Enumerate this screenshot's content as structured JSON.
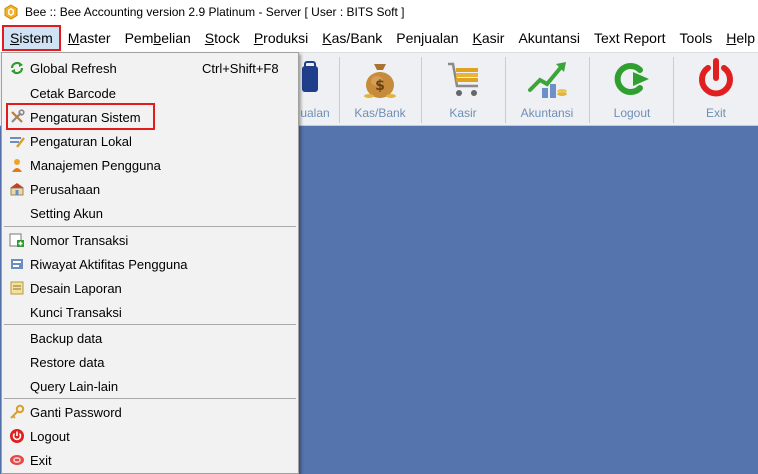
{
  "window": {
    "title": "Bee :: Bee Accounting version 2.9 Platinum - Server  [ User : BITS Soft ]"
  },
  "menubar": [
    {
      "pre": "",
      "u": "S",
      "post": "istem"
    },
    {
      "pre": "",
      "u": "M",
      "post": "aster"
    },
    {
      "pre": "Pem",
      "u": "b",
      "post": "elian"
    },
    {
      "pre": "",
      "u": "S",
      "post": "tock"
    },
    {
      "pre": "",
      "u": "P",
      "post": "roduksi"
    },
    {
      "pre": "",
      "u": "K",
      "post": "as/Bank"
    },
    {
      "pre": "Pen",
      "u": "j",
      "post": "ualan"
    },
    {
      "pre": "",
      "u": "K",
      "post": "asir"
    },
    {
      "pre": "Akuntansi",
      "u": "",
      "post": ""
    },
    {
      "pre": "Text Report",
      "u": "",
      "post": ""
    },
    {
      "pre": "Tools",
      "u": "",
      "post": ""
    },
    {
      "pre": "",
      "u": "H",
      "post": "elp"
    }
  ],
  "toolbar": {
    "partial_label": "ualan",
    "buttons": [
      {
        "label": "Kas/Bank",
        "icon": "money-bag-icon"
      },
      {
        "label": "Kasir",
        "icon": "cart-icon"
      },
      {
        "label": "Akuntansi",
        "icon": "chart-coins-icon"
      },
      {
        "label": "Logout",
        "icon": "logout-arrow-icon"
      },
      {
        "label": "Exit",
        "icon": "power-icon"
      }
    ]
  },
  "sistem_menu": {
    "groups": [
      [
        {
          "label": "Global Refresh",
          "shortcut": "Ctrl+Shift+F8",
          "icon": "refresh-icon"
        },
        {
          "label": "Cetak Barcode",
          "icon": ""
        },
        {
          "label": "Pengaturan Sistem",
          "icon": "tools-icon"
        },
        {
          "label": "Pengaturan Lokal",
          "icon": "edit-settings-icon"
        },
        {
          "label": "Manajemen Pengguna",
          "icon": "user-icon"
        },
        {
          "label": "Perusahaan",
          "icon": "company-icon"
        },
        {
          "label": "Setting Akun",
          "icon": ""
        }
      ],
      [
        {
          "label": "Nomor Transaksi",
          "icon": "add-number-icon"
        },
        {
          "label": "Riwayat Aktifitas Pengguna",
          "icon": "history-icon"
        },
        {
          "label": "Desain Laporan",
          "icon": "report-design-icon"
        },
        {
          "label": "Kunci Transaksi",
          "icon": ""
        }
      ],
      [
        {
          "label": "Backup data",
          "icon": ""
        },
        {
          "label": "Restore data",
          "icon": ""
        },
        {
          "label": "Query Lain-lain",
          "icon": ""
        }
      ],
      [
        {
          "label": "Ganti Password",
          "icon": "key-icon"
        },
        {
          "label": "Logout",
          "icon": "logout-icon"
        },
        {
          "label": "Exit",
          "icon": "exit-icon"
        }
      ]
    ]
  },
  "colors": {
    "workspace": "#5573ad",
    "highlight": "#e21b1b",
    "menu_bg": "#f2f2f2"
  }
}
